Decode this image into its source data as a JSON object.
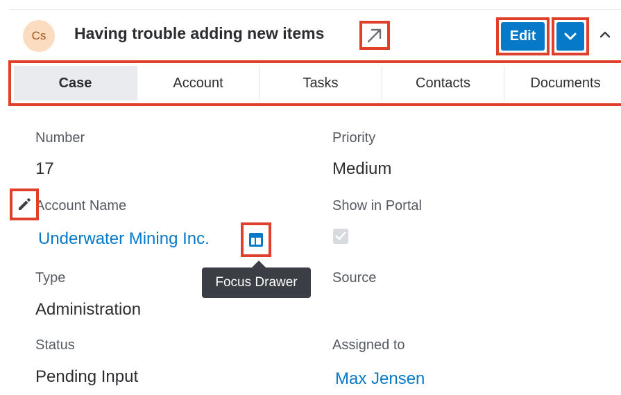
{
  "header": {
    "avatar_text": "Cs",
    "title": "Having trouble adding new items",
    "edit_label": "Edit",
    "icons": {
      "expand": "arrow-up-right-icon",
      "more": "chevron-down-icon",
      "collapse": "chevron-up-icon"
    }
  },
  "tabs": [
    {
      "label": "Case",
      "active": true
    },
    {
      "label": "Account",
      "active": false
    },
    {
      "label": "Tasks",
      "active": false
    },
    {
      "label": "Contacts",
      "active": false
    },
    {
      "label": "Documents",
      "active": false
    }
  ],
  "fields": {
    "number": {
      "label": "Number",
      "value": "17"
    },
    "priority": {
      "label": "Priority",
      "value": "Medium"
    },
    "account_name": {
      "label": "Account Name",
      "value": "Underwater Mining Inc."
    },
    "show_in_portal": {
      "label": "Show in Portal",
      "checked": true
    },
    "type": {
      "label": "Type",
      "value": "Administration"
    },
    "source": {
      "label": "Source",
      "value": ""
    },
    "status": {
      "label": "Status",
      "value": "Pending Input"
    },
    "assigned_to": {
      "label": "Assigned to",
      "value": "Max Jensen"
    }
  },
  "tooltip": {
    "text": "Focus Drawer"
  },
  "colors": {
    "accent": "#0679c8",
    "highlight_border": "#e0402b",
    "avatar_bg": "#fbdcc0",
    "tooltip_bg": "#3b3f45"
  }
}
